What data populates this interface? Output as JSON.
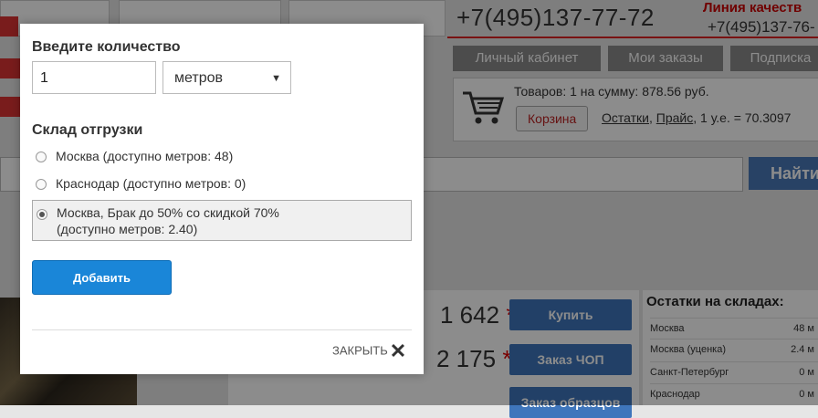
{
  "background": {
    "phone_main": "+7(495)137-77-72",
    "quality_line_title": "Линия качеств",
    "quality_line_phone": "+7(495)137-76-",
    "nav": [
      "Личный кабинет",
      "Мои заказы",
      "Подписка"
    ],
    "cart": {
      "summary": "Товаров: 1 на сумму: 878.56 руб.",
      "button": "Корзина",
      "link_stock": "Остатки",
      "link_price": "Прайс",
      "rate": ", 1 у.е. = 70.3097"
    },
    "search_button": "Найти",
    "prices": [
      {
        "value": "1 642",
        "star": "*"
      },
      {
        "value": "2 175",
        "star": "*"
      }
    ],
    "actions": [
      "Купить",
      "Заказ ЧОП",
      "Заказ образцов"
    ],
    "stock": {
      "title": "Остатки на складах:",
      "rows": [
        {
          "name": "Москва",
          "value": "48 м"
        },
        {
          "name": "Москва (уценка)",
          "value": "2.4 м"
        },
        {
          "name": "Санкт-Петербург",
          "value": "0 м"
        },
        {
          "name": "Краснодар",
          "value": "0 м"
        }
      ]
    }
  },
  "modal": {
    "quantity_label": "Введите количество",
    "quantity_value": "1",
    "unit_value": "метров",
    "warehouse_label": "Склад отгрузки",
    "options": [
      {
        "line1": "Москва (доступно метров: 48)",
        "line2": ""
      },
      {
        "line1": "Краснодар (доступно метров: 0)",
        "line2": ""
      },
      {
        "line1": "Москва, Брак до 50% со скидкой 70%",
        "line2": "(доступно метров: 2.40)"
      }
    ],
    "selected_option": 2,
    "add_button": "Добавить",
    "close_label": "ЗАКРЫТЬ",
    "close_glyph": "✕"
  },
  "colors": {
    "accent_blue": "#1a86d8",
    "action_blue": "#3f76bc",
    "red": "#d22222"
  }
}
